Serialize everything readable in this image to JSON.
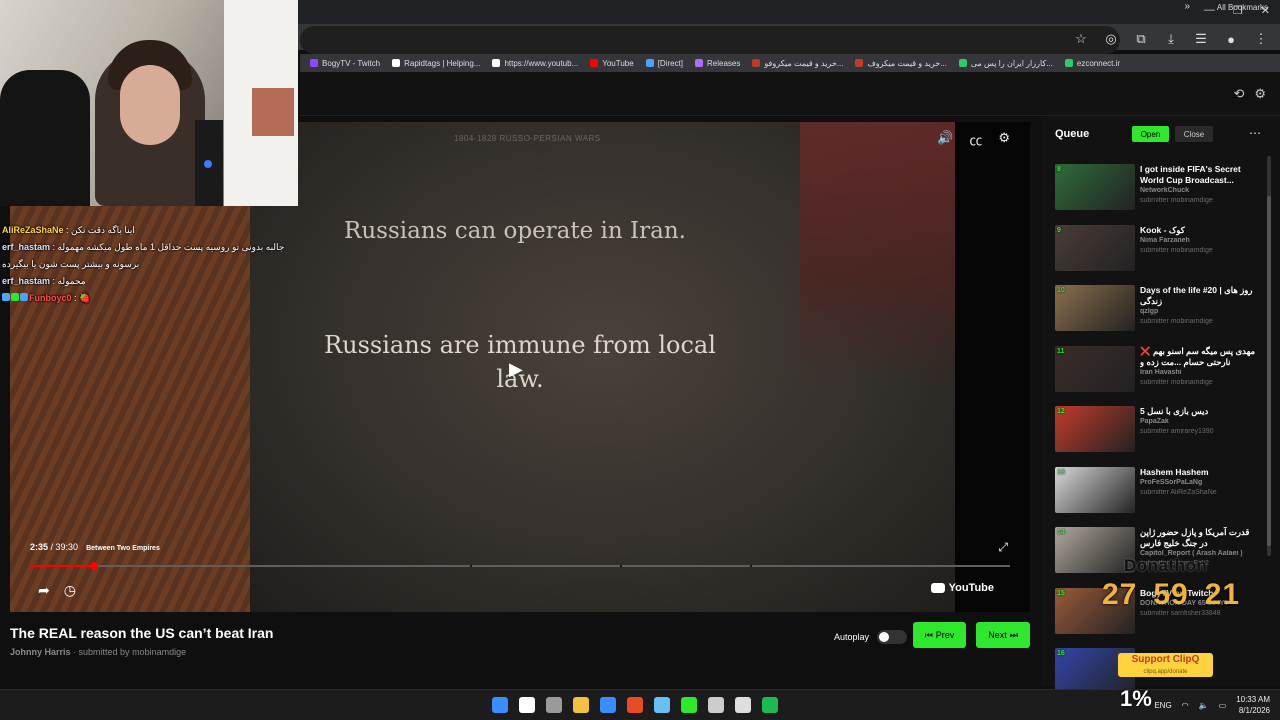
{
  "browser": {
    "bookmarks": [
      {
        "label": "BogyTV - Twitch",
        "color": "#9146ff"
      },
      {
        "label": "Rapidtags | Helping...",
        "color": "#ffffff"
      },
      {
        "label": "https://www.youtub...",
        "color": "#ffffff"
      },
      {
        "label": "YouTube",
        "color": "#ff0000"
      },
      {
        "label": "[Direct]",
        "color": "#4aa3ff"
      },
      {
        "label": "Releases",
        "color": "#b06bff"
      },
      {
        "label": "خرید و قیمت میکروفو...",
        "color": "#c0392b"
      },
      {
        "label": "خرید و قیمت میکروف...",
        "color": "#c0392b"
      },
      {
        "label": "کارزار ایران را پس می...",
        "color": "#2ecc71"
      },
      {
        "label": "ezconnect.ir",
        "color": "#2ecc71"
      }
    ],
    "all_bookmarks": "All Bookmarks",
    "more": "»"
  },
  "chat": [
    {
      "user": "AliReZaShaNe",
      "style": "",
      "text": " : اینا باگه دقت نکن"
    },
    {
      "user": "erf_hastam",
      "style": "blue",
      "text": " : جالبه بدونی تو روسیه پست حداقل 1 ماه طول میکشه مهموله"
    },
    {
      "user": "",
      "style": "",
      "text": "برسونه و بیشتر پست شون یا بیگیرده"
    },
    {
      "user": "erf_hastam",
      "style": "blue",
      "text": " : محموله"
    },
    {
      "user": "Funboyc0",
      "style": "red",
      "text": " : 🍓"
    }
  ],
  "video": {
    "dates": "1804-1828     RUSSO-PERSIAN WARS",
    "line1": "Russians can operate in Iran.",
    "line2": "Russians are immune from local law.",
    "time_current": "2:35",
    "time_sep": " / ",
    "time_total": "39:30",
    "chapter": "Between Two Empires",
    "progress": 0.0655,
    "logo": "YouTube"
  },
  "title": "The REAL reason the US can’t beat Iran",
  "channel": "Johnny Harris",
  "submitted_prefix": " · submitted by ",
  "submitted_by": "mobinamdige",
  "autoplay_label": "Autoplay",
  "prev_label": "Prev",
  "next_label": "Next",
  "queue": {
    "title": "Queue",
    "open": "Open",
    "close": "Close",
    "items": [
      {
        "num": "8",
        "title": "I got inside FIFA's Secret World Cup Broadcast...",
        "channel": "NetworkChuck",
        "sub": "submitter mobinamdige",
        "thumb": "#2f6b3a"
      },
      {
        "num": "9",
        "title": "Kook - کوک",
        "channel": "Nima Farzaneh",
        "sub": "submitter mobinamdige",
        "thumb": "#4a3c38"
      },
      {
        "num": "10",
        "title": "Days of the life #20 | روز های زندگی",
        "channel": "qzlgp",
        "sub": "submitter mobinamdige",
        "thumb": "#8a6e4c"
      },
      {
        "num": "11",
        "title": "مهدی پس میگه سم اسنو بهم ❌ نارحتی حسام ...مت زده و",
        "channel": "Iran Havashi",
        "sub": "submitter mobinamdige",
        "thumb": "#3a2c2a"
      },
      {
        "num": "12",
        "title": "دیس بازی با نسل 5",
        "channel": "PapaZak",
        "sub": "submitter amirarey1390",
        "thumb": "#c23b2a"
      },
      {
        "num": "13",
        "title": "Hashem Hashem",
        "channel": "ProFeSSorPaLaNg",
        "sub": "submitter AliReZaShaNe",
        "thumb": "#d9d9d9"
      },
      {
        "num": "14",
        "title": "قدرت آمریکا و پازل حضور ژاپن در جنگ خلیج فارس",
        "channel": "Capitol_Report ( Arash Aalaei )",
        "sub": "submitter mosm_Feli2",
        "thumb": "#b0a89c"
      },
      {
        "num": "15",
        "title": "BogyTV on Twitch",
        "channel": "DONATHON DAY 65 1d IYT",
        "sub": "submitter samfisher33848",
        "thumb": "#9a5a3a"
      },
      {
        "num": "16",
        "title": "",
        "channel": "",
        "sub": "",
        "thumb": "#3344aa"
      }
    ]
  },
  "overlay": {
    "donathon": "Donathon",
    "timer": [
      "27",
      "59",
      "21"
    ],
    "clipq_title": "Support ClipQ",
    "clipq_url": "clipq.app/donate",
    "percent": "1%"
  },
  "taskbar": {
    "lang": "ENG",
    "time": "10:33 AM",
    "date": "8/1/2026",
    "apps": [
      "#3a8dff",
      "#ffffff",
      "#9a9a9a",
      "#f5c042",
      "#3a8dff",
      "#e44d26",
      "#66c0f4",
      "#2ee82e",
      "#cccccc",
      "#dddddd",
      "#1db954"
    ]
  }
}
